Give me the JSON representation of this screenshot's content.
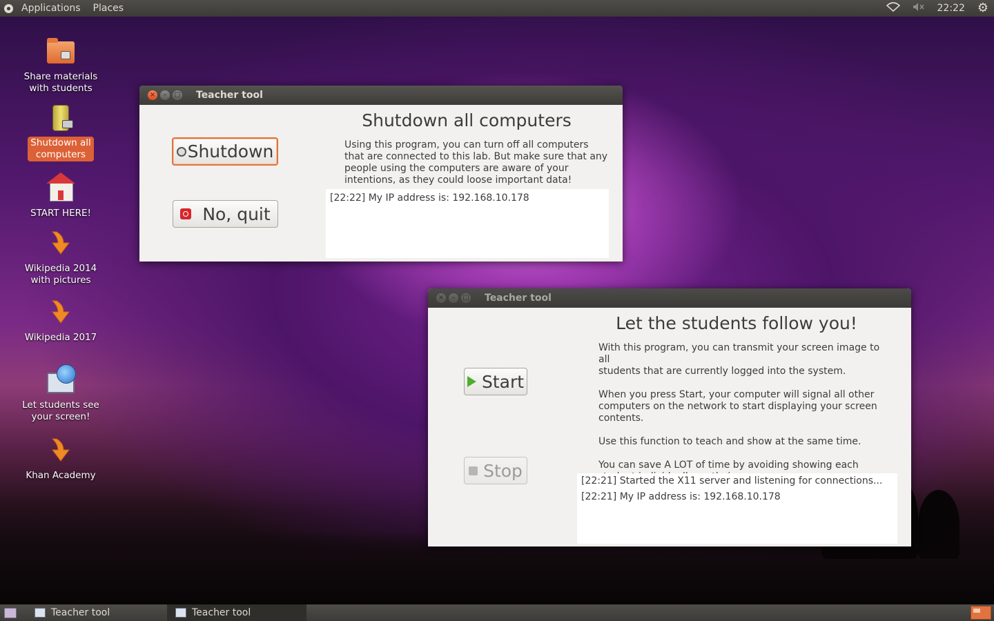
{
  "top_panel": {
    "menus": [
      "Applications",
      "Places"
    ],
    "clock": "22:22",
    "tray_icons": [
      "wifi-icon",
      "volume-muted-icon",
      "settings-gear-icon"
    ]
  },
  "desktop_icons": [
    {
      "label": "Share materials\nwith students",
      "icon": "folder-share-icon"
    },
    {
      "label": "Shutdown all\ncomputers",
      "icon": "battery-plug-icon",
      "selected": true
    },
    {
      "label": "START HERE!",
      "icon": "house-icon"
    },
    {
      "label": "Wikipedia 2014\nwith pictures",
      "icon": "orange-arrow-icon"
    },
    {
      "label": "Wikipedia 2017",
      "icon": "orange-arrow-icon"
    },
    {
      "label": "Let students see\nyour screen!",
      "icon": "monitor-globe-icon"
    },
    {
      "label": "Khan Academy",
      "icon": "orange-arrow-icon"
    }
  ],
  "shutdown_window": {
    "title": "Teacher tool",
    "heading": "Shutdown all computers",
    "description": "Using this program, you can turn off all computers\nthat are connected to this lab. But make sure that any\npeople using the computers are aware of your\nintentions, as they could loose important data!",
    "shutdown_label": "Shutdown",
    "quit_label": "No, quit",
    "log": [
      "[22:22] My IP address is: 192.168.10.178"
    ]
  },
  "follow_window": {
    "title": "Teacher tool",
    "heading": "Let the students follow you!",
    "description": "With this program, you can transmit your screen image to all\nstudents that are currently logged into the system.\n\nWhen you press Start, your computer will signal all other\ncomputers on the network to start displaying your screen\ncontents.\n\nUse this function to teach and show at the same time.\n\nYou can save A LOT of time by avoiding showing each\nstudent individually on their screen.",
    "start_label": "Start",
    "stop_label": "Stop",
    "log": [
      "[22:21] Started the X11 server and listening for connections...",
      "[22:21] My IP address is: 192.168.10.178"
    ]
  },
  "bottom_panel": {
    "tasks": [
      {
        "label": "Teacher tool",
        "active": false
      },
      {
        "label": "Teacher tool",
        "active": true
      }
    ]
  },
  "colors": {
    "accent_orange": "#e0733f",
    "selected_label": "#dd6136",
    "panel": "#3c3b37"
  }
}
